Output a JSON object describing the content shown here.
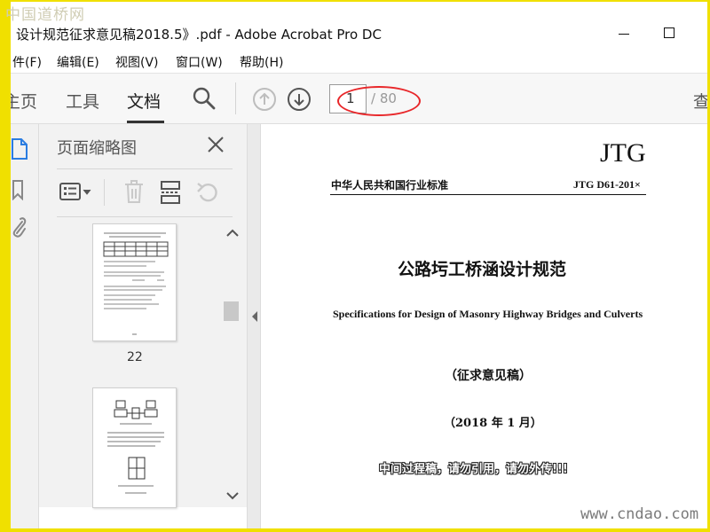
{
  "watermarks": {
    "top": "中国道桥网",
    "bottom": "www.cndao.com"
  },
  "window": {
    "title": "设计规范征求意见稿2018.5》.pdf - Adobe Acrobat Pro DC"
  },
  "menu": {
    "items": [
      "件(F)",
      "编辑(E)",
      "视图(V)",
      "窗口(W)",
      "帮助(H)"
    ]
  },
  "toolbar": {
    "tabs": [
      "主页",
      "工具",
      "文档"
    ],
    "active_tab": "文档",
    "page_current": "1",
    "page_total": "/ 80",
    "right_clipped": "查"
  },
  "thumbnail_panel": {
    "title": "页面缩略图",
    "thumbnails": [
      {
        "label": "22"
      },
      {
        "label": ""
      }
    ]
  },
  "document": {
    "jtg": "JTG",
    "issuer": "中华人民共和国行业标准",
    "code": "JTG D61-201×",
    "title_cn": "公路圬工桥涵设计规范",
    "title_en": "Specifications for Design of Masonry Highway Bridges and Culverts",
    "draft": "（征求意见稿）",
    "date": "（2018 年 1 月）",
    "notice": "中间过程稿，请勿引用，请勿外传!!!"
  },
  "colors": {
    "frame": "#f0e000",
    "annotation": "#e8272a"
  }
}
